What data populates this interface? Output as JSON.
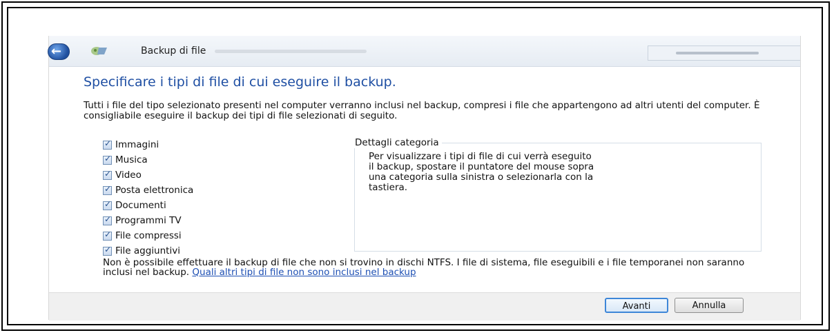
{
  "titlebar": {
    "breadcrumb": "Backup di file"
  },
  "main": {
    "heading": "Specificare i tipi di file di cui eseguire il backup.",
    "description": "Tutti i file del tipo selezionato presenti nel computer verranno inclusi nel backup, compresi i file che appartengono ad altri utenti del computer. È consigliabile eseguire il backup dei tipi di file selezionati di seguito."
  },
  "categories": [
    {
      "label": "Immagini",
      "checked": true
    },
    {
      "label": "Musica",
      "checked": true
    },
    {
      "label": "Video",
      "checked": true
    },
    {
      "label": "Posta elettronica",
      "checked": true
    },
    {
      "label": "Documenti",
      "checked": true
    },
    {
      "label": "Programmi TV",
      "checked": true
    },
    {
      "label": "File compressi",
      "checked": true
    },
    {
      "label": "File aggiuntivi",
      "checked": true
    }
  ],
  "details": {
    "title": "Dettagli categoria",
    "text": "Per visualizzare i tipi di file di cui verrà eseguito il backup, spostare il puntatore del mouse sopra una categoria sulla sinistra o selezionarla con la tastiera."
  },
  "note": {
    "text": "Non è possibile effettuare il backup di file che non si trovino in dischi NTFS. I file di sistema, file eseguibili e i file temporanei non saranno inclusi nel backup. ",
    "link": "Quali altri tipi di file non sono inclusi nel backup"
  },
  "buttons": {
    "next": "Avanti",
    "cancel": "Annulla"
  }
}
